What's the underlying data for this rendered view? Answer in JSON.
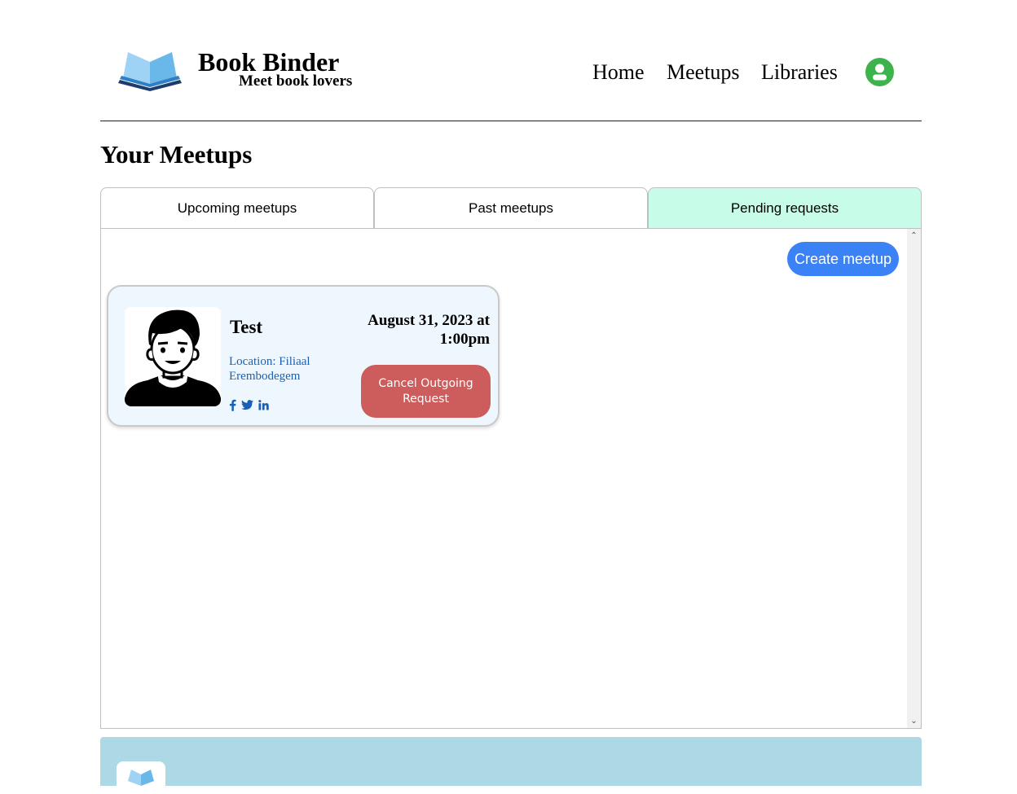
{
  "header": {
    "brand_title": "Book Binder",
    "brand_subtitle": "Meet book lovers",
    "logo_icon": "open-book-icon",
    "nav": {
      "home": "Home",
      "meetups": "Meetups",
      "libraries": "Libraries"
    },
    "account_icon": "user-account-icon",
    "account_color": "#3cb44b"
  },
  "page": {
    "title": "Your Meetups"
  },
  "tabs": [
    {
      "label": "Upcoming meetups",
      "active": false
    },
    {
      "label": "Past meetups",
      "active": false
    },
    {
      "label": "Pending requests",
      "active": true
    }
  ],
  "actions": {
    "create_meetup": "Create meetup"
  },
  "meetups": [
    {
      "name": "Test",
      "location": "Location: Filiaal Erembodegem",
      "date": "August 31, 2023 at 1:00pm",
      "action_label": "Cancel Outgoing Request",
      "social_icons": [
        "facebook-icon",
        "twitter-icon",
        "linkedin-icon"
      ]
    }
  ],
  "colors": {
    "active_tab": "#c6fce8",
    "primary_button": "#3b82f6",
    "cancel_button": "#cd5c5c",
    "card_background": "#eff7fe",
    "footer": "#add8e6",
    "link": "#1a5fb4"
  }
}
